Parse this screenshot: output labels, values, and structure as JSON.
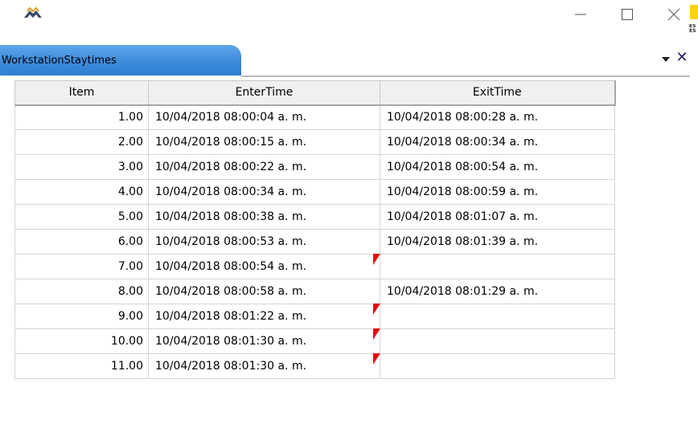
{
  "window": {
    "controls": [
      "minimize-icon",
      "maximize-icon",
      "close-icon"
    ],
    "edge_badge_color": "#ffd400"
  },
  "tab": {
    "label": "WorkstationStaytimes",
    "color": "#3c8bdb"
  },
  "table": {
    "columns": [
      "Item",
      "EnterTime",
      "ExitTime"
    ],
    "rows": [
      {
        "item": "1.00",
        "enter": "10/04/2018 08:00:04 a. m.",
        "exit": "10/04/2018 08:00:28 a. m.",
        "missing_exit": false
      },
      {
        "item": "2.00",
        "enter": "10/04/2018 08:00:15 a. m.",
        "exit": "10/04/2018 08:00:34 a. m.",
        "missing_exit": false
      },
      {
        "item": "3.00",
        "enter": "10/04/2018 08:00:22 a. m.",
        "exit": "10/04/2018 08:00:54 a. m.",
        "missing_exit": false
      },
      {
        "item": "4.00",
        "enter": "10/04/2018 08:00:34 a. m.",
        "exit": "10/04/2018 08:00:59 a. m.",
        "missing_exit": false
      },
      {
        "item": "5.00",
        "enter": "10/04/2018 08:00:38 a. m.",
        "exit": "10/04/2018 08:01:07 a. m.",
        "missing_exit": false
      },
      {
        "item": "6.00",
        "enter": "10/04/2018 08:00:53 a. m.",
        "exit": "10/04/2018 08:01:39 a. m.",
        "missing_exit": false
      },
      {
        "item": "7.00",
        "enter": "10/04/2018 08:00:54 a. m.",
        "exit": "",
        "missing_exit": true
      },
      {
        "item": "8.00",
        "enter": "10/04/2018 08:00:58 a. m.",
        "exit": "10/04/2018 08:01:29 a. m.",
        "missing_exit": false
      },
      {
        "item": "9.00",
        "enter": "10/04/2018 08:01:22 a. m.",
        "exit": "",
        "missing_exit": true
      },
      {
        "item": "10.00",
        "enter": "10/04/2018 08:01:30 a. m.",
        "exit": "",
        "missing_exit": true
      },
      {
        "item": "11.00",
        "enter": "10/04/2018 08:01:30 a. m.",
        "exit": "",
        "missing_exit": true
      }
    ],
    "flag_color": "#e01010"
  }
}
